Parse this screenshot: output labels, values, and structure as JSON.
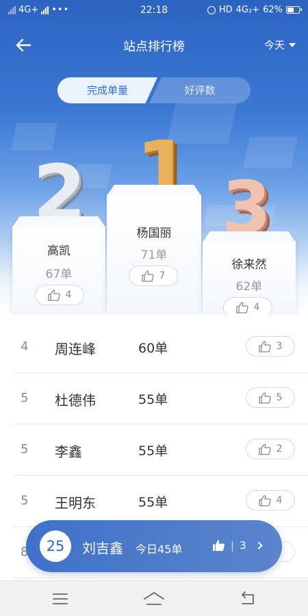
{
  "status_bar": {
    "network_left": "4G+",
    "time": "22:18",
    "network_right": "HD",
    "network_right_gen": "4G₂+",
    "battery_percent": "62%",
    "battery_level": 0.62
  },
  "nav": {
    "title": "站点排行榜",
    "date_filter": "今天"
  },
  "tabs": [
    {
      "label": "完成单量",
      "active": true
    },
    {
      "label": "好评数",
      "active": false
    }
  ],
  "podium": {
    "first": {
      "rank": "1",
      "name": "杨国丽",
      "count": "71单",
      "likes": "7"
    },
    "second": {
      "rank": "2",
      "name": "高凯",
      "count": "67单",
      "likes": "4"
    },
    "third": {
      "rank": "3",
      "name": "徐来然",
      "count": "62单",
      "likes": "4"
    }
  },
  "ranking": [
    {
      "rank": "4",
      "name": "周连峰",
      "count": "60单",
      "likes": "3"
    },
    {
      "rank": "5",
      "name": "杜德伟",
      "count": "55单",
      "likes": "5"
    },
    {
      "rank": "5",
      "name": "李鑫",
      "count": "55单",
      "likes": "2"
    },
    {
      "rank": "5",
      "name": "王明东",
      "count": "55单",
      "likes": "4"
    },
    {
      "rank": "8",
      "name": "",
      "count": "",
      "likes": ""
    }
  ],
  "my_rank": {
    "rank": "25",
    "name": "刘吉鑫",
    "today_count": "今日45单",
    "separator": "|",
    "likes": "3"
  },
  "colors": {
    "primary": "#2f6fd0",
    "gold": "#e9b15b",
    "silver": "#e9ecf3",
    "bronze": "#f0c2b0"
  }
}
